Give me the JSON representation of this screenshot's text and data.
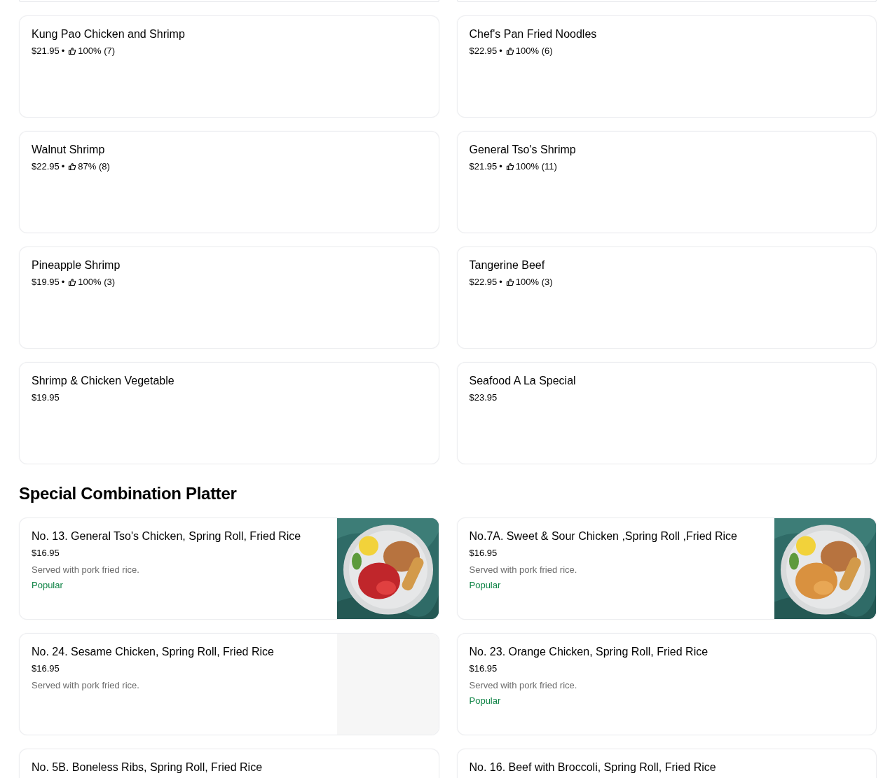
{
  "sections": [
    {
      "items": [
        {
          "name": "Kung Pao Chicken and Shrimp",
          "price": "$21.95",
          "separator": "•",
          "rating": "100% (7)"
        },
        {
          "name": "Chef's Pan Fried Noodles",
          "price": "$22.95",
          "separator": "•",
          "rating": "100% (6)"
        },
        {
          "name": "Walnut Shrimp",
          "price": "$22.95",
          "separator": "•",
          "rating": "87% (8)"
        },
        {
          "name": "General Tso's Shrimp",
          "price": "$21.95",
          "separator": "•",
          "rating": "100% (11)"
        },
        {
          "name": "Pineapple Shrimp",
          "price": "$19.95",
          "separator": "•",
          "rating": "100% (3)"
        },
        {
          "name": "Tangerine Beef",
          "price": "$22.95",
          "separator": "•",
          "rating": "100% (3)"
        },
        {
          "name": "Shrimp & Chicken Vegetable",
          "price": "$19.95"
        },
        {
          "name": "Seafood A La Special",
          "price": "$23.95"
        }
      ]
    },
    {
      "title": "Special Combination Platter",
      "items": [
        {
          "name": "No. 13. General Tso's Chicken, Spring Roll, Fried Rice",
          "price": "$16.95",
          "description": "Served with pork fried rice.",
          "badge": "Popular"
        },
        {
          "name": "No.7A. Sweet & Sour Chicken ,Spring Roll ,Fried Rice",
          "price": "$16.95",
          "description": "Served with pork fried rice.",
          "badge": "Popular"
        },
        {
          "name": "No. 24. Sesame Chicken, Spring Roll, Fried Rice",
          "price": "$16.95",
          "description": "Served with pork fried rice.",
          "image": {
            "kind": "empty"
          }
        },
        {
          "name": "No. 23. Orange Chicken, Spring Roll, Fried Rice",
          "price": "$16.95",
          "description": "Served with pork fried rice.",
          "badge": "Popular"
        },
        {
          "name": "No. 5B. Boneless Ribs, Spring Roll, Fried Rice"
        },
        {
          "name": "No. 16. Beef with Broccoli, Spring Roll, Fried Rice"
        }
      ]
    }
  ]
}
